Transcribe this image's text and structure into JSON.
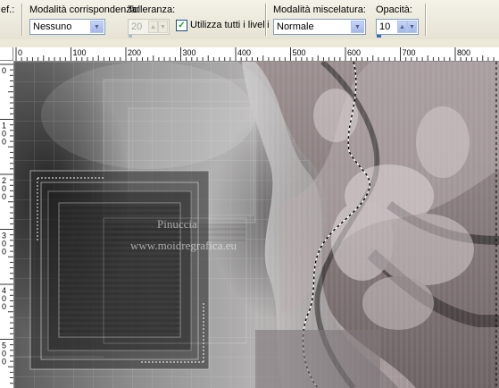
{
  "toolbar": {
    "partial_label": "ef.:",
    "mode_label": "Modalità corrispondenza:",
    "mode_value": "Nessuno",
    "tolerance_label": "Tolleranza:",
    "tolerance_value": "20",
    "use_all_layers_label": "Utilizza tutti i livelli",
    "use_all_layers_checked": true,
    "blend_label": "Modalità miscelatura:",
    "blend_value": "Normale",
    "opacity_label": "Opacità:",
    "opacity_value": "10"
  },
  "ruler_h": {
    "ticks": [
      "0",
      "100",
      "200",
      "300",
      "400",
      "500",
      "600",
      "700",
      "800"
    ]
  },
  "ruler_v": {
    "ticks": [
      "0",
      "100",
      "200",
      "300",
      "400",
      "500"
    ]
  },
  "watermark": {
    "line1": "Pinuccia",
    "line2": "www.moidregrafica.eu"
  },
  "icons": {
    "checkbox": "check-icon",
    "combo_arrow": "chevron-down-icon",
    "spin_up": "arrow-up-icon",
    "spin_down": "arrow-down-icon"
  }
}
